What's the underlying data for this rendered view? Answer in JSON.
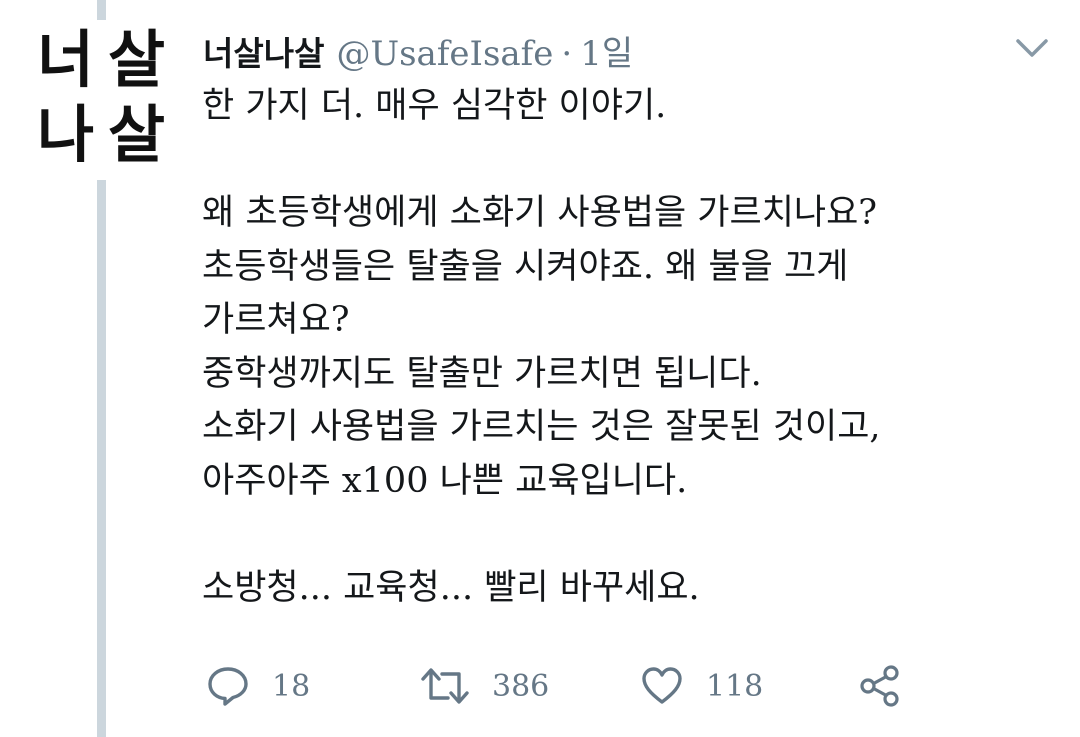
{
  "tweet": {
    "display_name": "너살나살",
    "handle": "@UsafeIsafe",
    "separator": "·",
    "time": "1일",
    "avatar_chars": [
      "너",
      "살",
      "나",
      "살"
    ],
    "text": "한 가지 더. 매우 심각한 이야기.\n\n왜 초등학생에게 소화기 사용법을 가르치나요?\n초등학생들은 탈출을 시켜야죠. 왜 불을 끄게\n가르쳐요?\n중학생까지도 탈출만 가르치면 됩니다.\n소화기 사용법을 가르치는 것은 잘못된 것이고,\n아주아주 x100 나쁜 교육입니다.\n\n소방청... 교육청... 빨리 바꾸세요."
  },
  "actions": {
    "reply": {
      "icon": "reply-icon",
      "count": "18"
    },
    "retweet": {
      "icon": "retweet-icon",
      "count": "386"
    },
    "like": {
      "icon": "heart-icon",
      "count": "118"
    },
    "share": {
      "icon": "share-icon"
    }
  },
  "colors": {
    "text": "#14171a",
    "secondary": "#657786",
    "thread_line": "#ccd6dd"
  }
}
